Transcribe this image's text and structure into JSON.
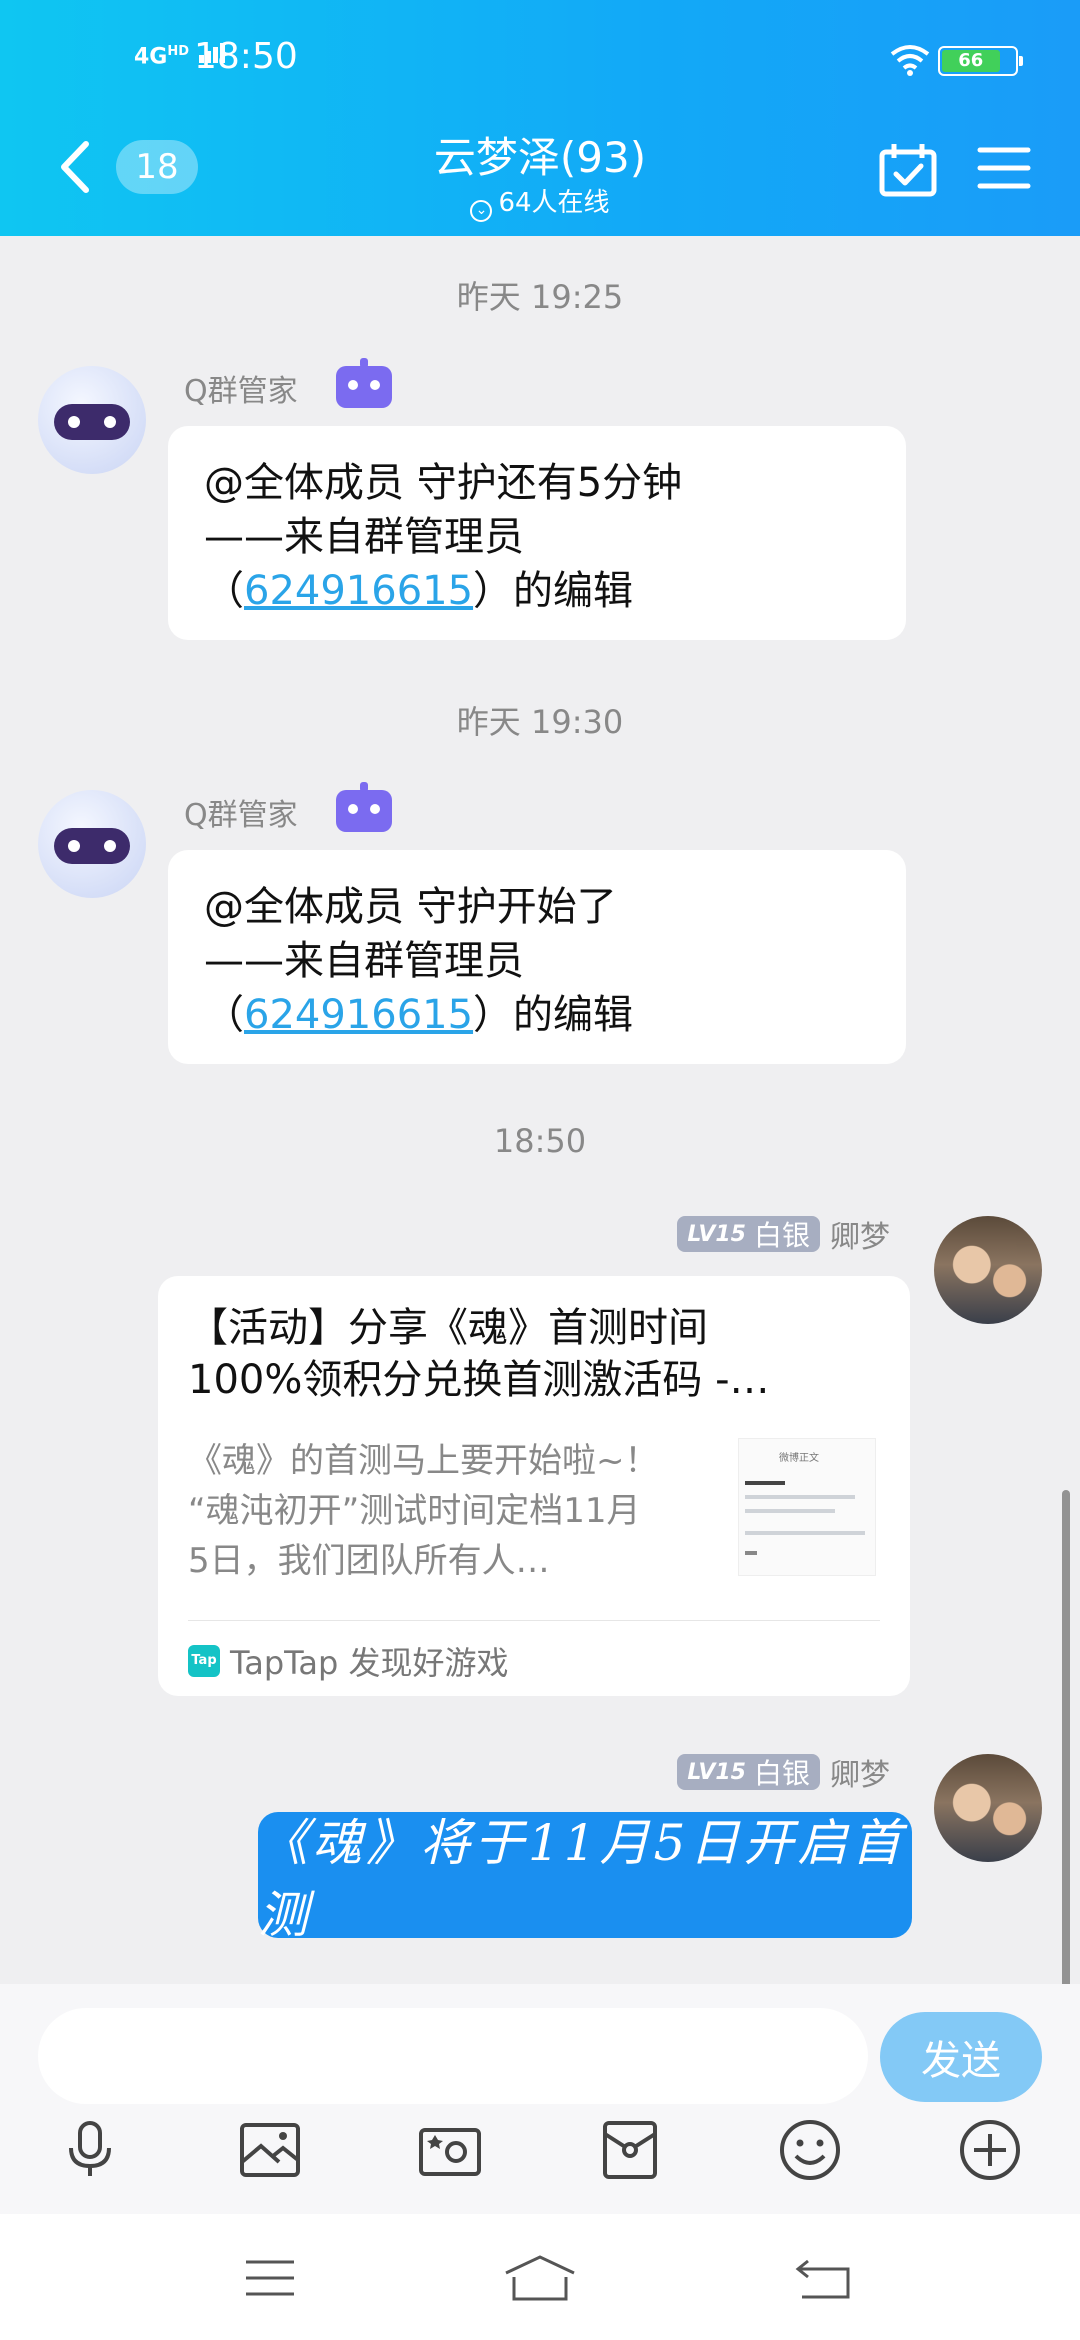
{
  "status_bar": {
    "network": "4G",
    "network_sup": "HD",
    "time": "18:50",
    "battery": "66"
  },
  "header": {
    "unread_count": "18",
    "title": "云梦泽(93)",
    "online": "64人在线"
  },
  "messages": [
    {
      "timestamp": "昨天 19:25",
      "sender": "Q群管家",
      "line1": "@全体成员 守护还有5分钟",
      "line2": "——来自群管理员",
      "paren_open": "（",
      "link": "624916615",
      "line3_tail": "）的编辑"
    },
    {
      "timestamp": "昨天 19:30",
      "sender": "Q群管家",
      "line1": "@全体成员 守护开始了",
      "line2": "——来自群管理员",
      "paren_open": "（",
      "link": "624916615",
      "line3_tail": "）的编辑"
    }
  ],
  "timestamp3": "18:50",
  "user": {
    "level": "LV15",
    "rank": "白银",
    "name": "卿梦"
  },
  "share_card": {
    "title_line1": "【活动】分享《魂》首测时间",
    "title_line2": "100%领积分兑换首测激活码 -…",
    "desc_line1": "《魂》的首测马上要开始啦~！",
    "desc_line2": "“魂沌初开”测试时间定档11月",
    "desc_line3": "5日，我们团队所有人…",
    "thumb_title": "微博正文",
    "source": "TapTap 发现好游戏",
    "source_icon_text": "Tap"
  },
  "image_message_text": "《魂》将于11月5日开启首测",
  "input": {
    "placeholder": "",
    "value": "",
    "send_label": "发送"
  },
  "toolbar": [
    "mic-icon",
    "photo-icon",
    "camera-icon",
    "red-packet-icon",
    "emoji-icon",
    "plus-icon"
  ],
  "colors": {
    "header_start": "#0fc6f2",
    "header_end": "#1a9cf8",
    "link": "#2aa4e8",
    "send_button": "#83c9f6",
    "blue_bubble": "#1a8ff0",
    "robot_tag": "#7b6bf0"
  }
}
